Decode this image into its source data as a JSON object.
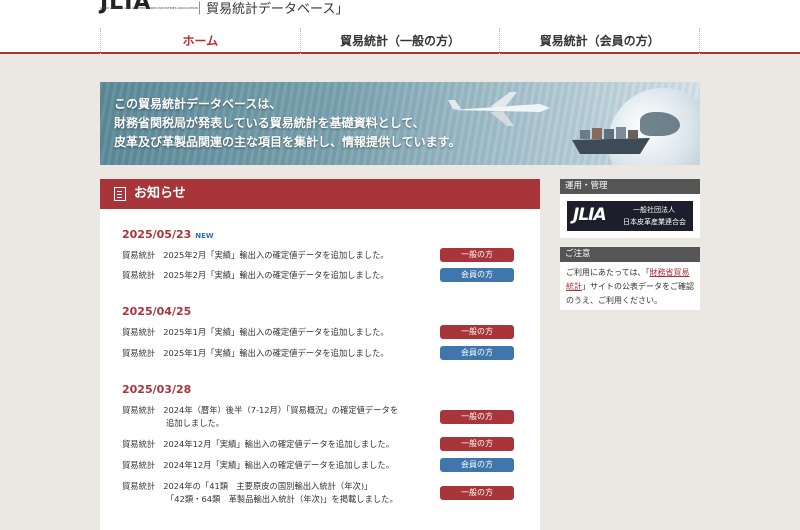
{
  "header": {
    "logo_text": "JLIA",
    "logo_subtitle": "JAPAN LEATHER AND LEATHER GOODS INDUSTRIES ASSOCIATION",
    "site_title": "｜貿易統計データベース」"
  },
  "nav": {
    "home": "ホーム",
    "general": "貿易統計（一般の方）",
    "members": "貿易統計（会員の方）"
  },
  "banner": {
    "line1": "この貿易統計データベースは、",
    "line2": "財務省関税局が発表している貿易統計を基礎資料として、",
    "line3": "皮革及び革製品関連の主な項目を集計し、情報提供しています。"
  },
  "notices": {
    "title": "お知らせ",
    "new_badge": "NEW",
    "groups": [
      {
        "date": "2025/05/23",
        "entries": [
          {
            "category": "貿易統計",
            "text": "2025年2月「実績」輸出入の確定値データを追加しました。",
            "button": "一般の方"
          },
          {
            "category": "貿易統計",
            "text": "2025年2月「実績」輸出入の確定値データを追加しました。",
            "button": "会員の方"
          }
        ]
      },
      {
        "date": "2025/04/25",
        "entries": [
          {
            "category": "貿易統計",
            "text": "2025年1月「実績」輸出入の確定値データを追加しました。",
            "button": "一般の方"
          },
          {
            "category": "貿易統計",
            "text": "2025年1月「実績」輸出入の確定値データを追加しました。",
            "button": "会員の方"
          }
        ]
      },
      {
        "date": "2025/03/28",
        "entries": [
          {
            "category": "貿易統計",
            "text": "2024年（暦年）後半（7-12月）「貿易概況」の確定値データを",
            "text2": "追加しました。",
            "button": "一般の方"
          },
          {
            "category": "貿易統計",
            "text": "2024年12月「実績」輸出入の確定値データを追加しました。",
            "button": "一般の方"
          },
          {
            "category": "貿易統計",
            "text": "2024年12月「実績」輸出入の確定値データを追加しました。",
            "button": "会員の方"
          },
          {
            "category": "貿易統計",
            "text": "2024年の「41類　主要原皮の国別輸出入統計（年次)」",
            "text2": "「42類・64類　革製品輸出入統計（年次)」を掲載しました。",
            "button": "一般の方"
          }
        ]
      }
    ]
  },
  "sidebar": {
    "operation_title": "運用・管理",
    "jlia_mark": "JLIA",
    "jlia_org1": "一般社団法人",
    "jlia_org2": "日本皮革産業連合会",
    "caution_title": "ご注意",
    "caution_pre": "ご利用にあたっては、「",
    "caution_link": "財務省貿易統計",
    "caution_post": "」サイトの公表データをご確認のうえ、ご利用ください。"
  },
  "colors": {
    "accent": "#a8353a",
    "member_blue": "#3e76ad",
    "background": "#ebe7e2"
  }
}
